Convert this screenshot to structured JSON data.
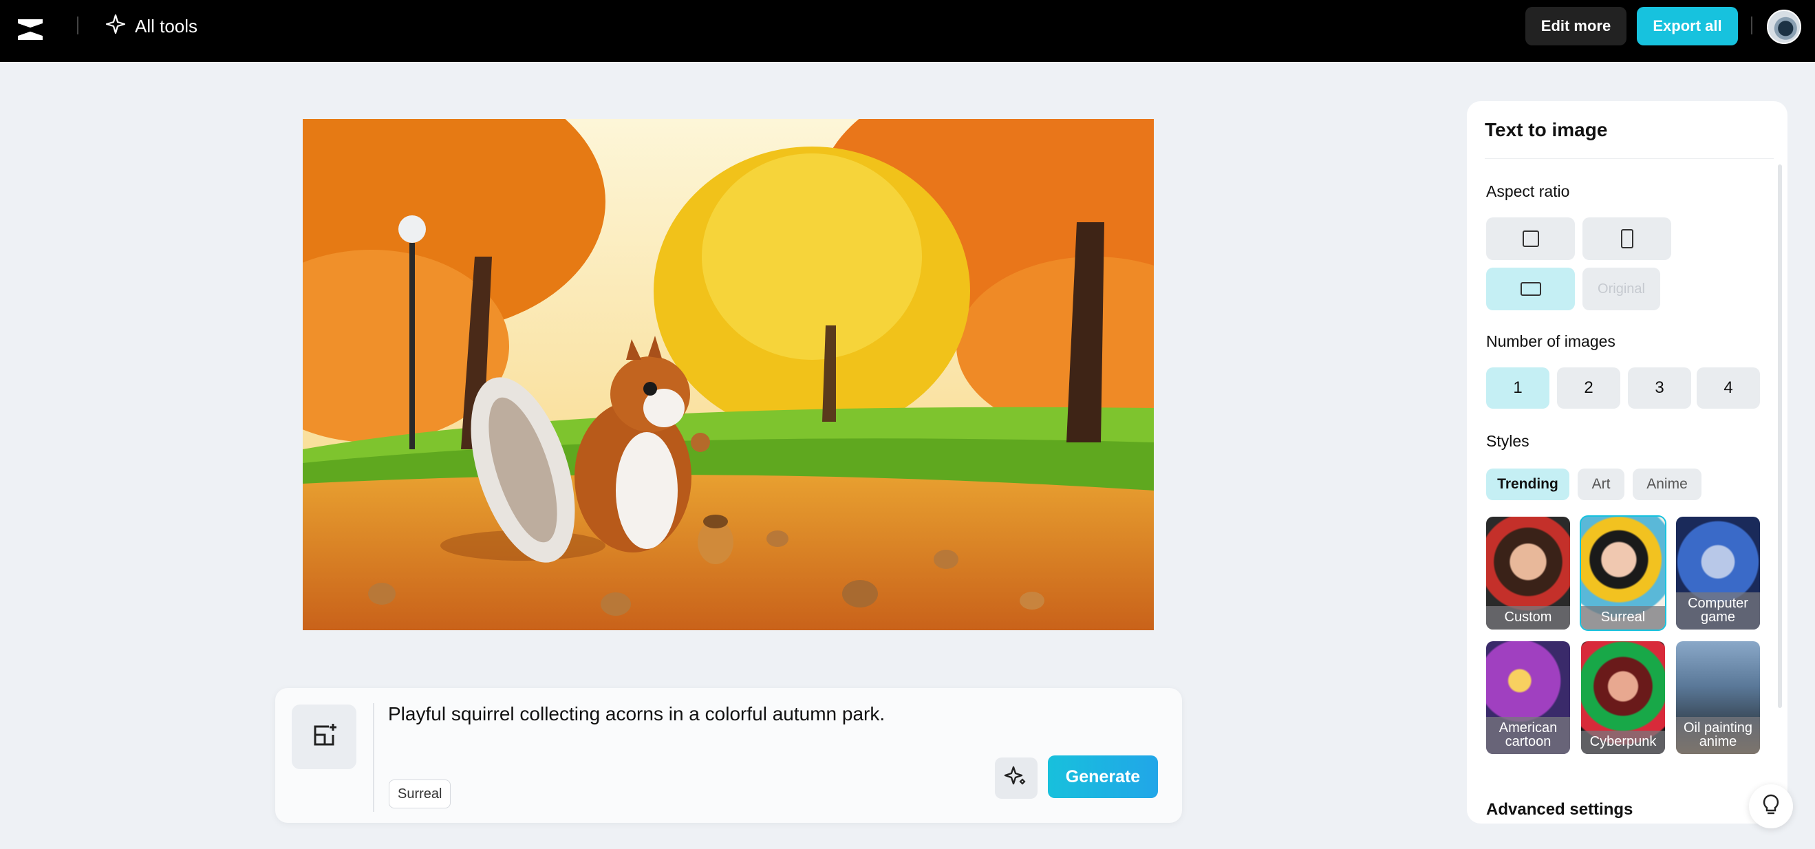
{
  "topbar": {
    "logo_icon": "capcut-logo-icon",
    "all_tools_label": "All tools",
    "edit_more_label": "Edit more",
    "export_all_label": "Export all",
    "export_color": "#17c2de"
  },
  "canvas": {
    "image_icon": "generated-autumn-squirrel-image"
  },
  "prompt": {
    "text": "Playful squirrel collecting acorns in a colorful autumn park.",
    "style_tag": "Surreal",
    "generate_label": "Generate"
  },
  "panel": {
    "title": "Text to image",
    "aspect_ratio_label": "Aspect ratio",
    "aspect_original_label": "Original",
    "aspect_selected": "landscape",
    "number_label": "Number of images",
    "numbers": [
      "1",
      "2",
      "3",
      "4"
    ],
    "number_selected": "1",
    "styles_label": "Styles",
    "style_tabs": [
      "Trending",
      "Art",
      "Anime"
    ],
    "style_tab_selected": "Trending",
    "style_cards": [
      {
        "line1": "Custom",
        "line2": ""
      },
      {
        "line1": "Surreal",
        "line2": ""
      },
      {
        "line1": "Computer",
        "line2": "game"
      },
      {
        "line1": "American",
        "line2": "cartoon"
      },
      {
        "line1": "Cyberpunk",
        "line2": ""
      },
      {
        "line1": "Oil painting",
        "line2": "anime"
      }
    ],
    "style_card_selected": "Surreal",
    "advanced_label": "Advanced settings",
    "accent_selected": "#c5eff4"
  }
}
